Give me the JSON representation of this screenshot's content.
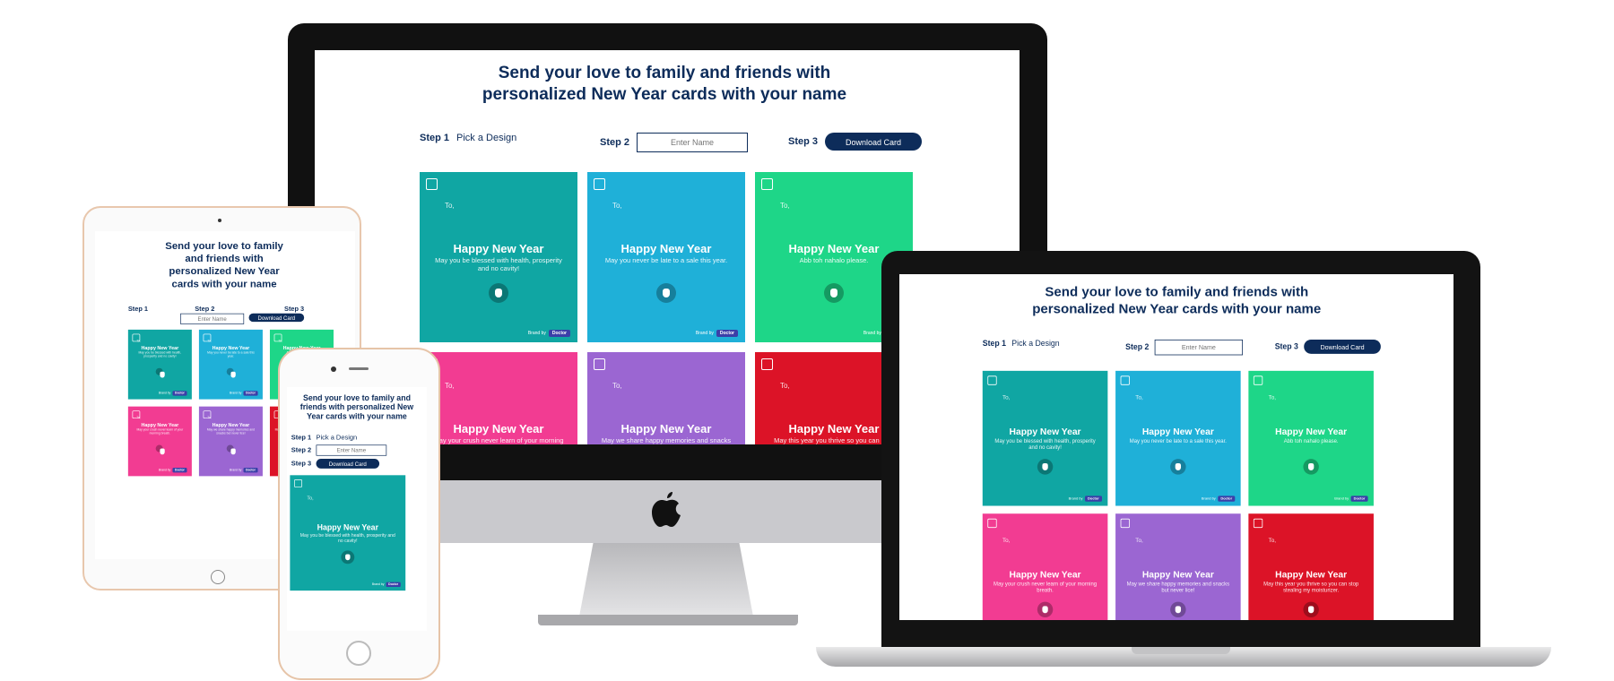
{
  "page": {
    "title_line1": "Send your love to family and friends with",
    "title_line2": "personalized New Year cards with your name",
    "title_full": "Send your love to family and friends with personalized New Year cards with your name"
  },
  "steps": {
    "step1_label": "Step 1",
    "step1_text": "Pick a Design",
    "step2_label": "Step 2",
    "step2_placeholder": "Enter Name",
    "step3_label": "Step 3",
    "download_label": "Download Card"
  },
  "cards": [
    {
      "to": "To,",
      "title": "Happy New Year",
      "message": "May you be blessed with health, prosperity and no cavity!",
      "color": "#10a6a3",
      "brand_prefix": "Brand by",
      "brand": "Doctor"
    },
    {
      "to": "To,",
      "title": "Happy New Year",
      "message": "May you never be late to a sale this year.",
      "color": "#1fb0d8",
      "brand_prefix": "Brand by",
      "brand": "Doctor"
    },
    {
      "to": "To,",
      "title": "Happy New Year",
      "message": "Abb toh nahalo please.",
      "color": "#1ed688",
      "brand_prefix": "Brand by",
      "brand": "Doctor"
    },
    {
      "to": "To,",
      "title": "Happy New Year",
      "message": "May your crush never learn of your morning breath.",
      "color": "#f23c92",
      "brand_prefix": "Brand by",
      "brand": "Doctor"
    },
    {
      "to": "To,",
      "title": "Happy New Year",
      "message": "May we share happy memories and snacks but never lice!",
      "color": "#9b66d2",
      "brand_prefix": "Brand by",
      "brand": "Doctor"
    },
    {
      "to": "To,",
      "title": "Happy New Year",
      "message": "May this year you thrive so you can stop stealing my moisturizer.",
      "color": "#dc1327",
      "brand_prefix": "Brand by",
      "brand": "Doctor"
    }
  ],
  "icons": {
    "checkbox": "checkbox-icon",
    "tooth_logo": "tooth-logo-icon",
    "apple_logo": "apple-logo-icon"
  }
}
